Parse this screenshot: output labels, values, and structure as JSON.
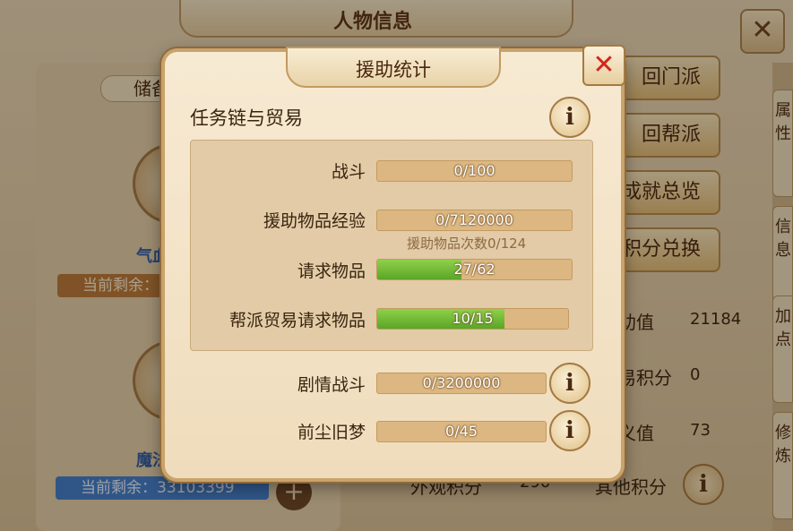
{
  "background": {
    "title": "人物信息",
    "close_icon": "close-icon",
    "left": {
      "store_label": "储备",
      "qi_label": "气血",
      "remain1_label": "当前剩余：",
      "mo_label": "魔法",
      "remain2_label": "当前剩余：33103399",
      "plus_icon": "plus-icon"
    },
    "buttons": [
      "回门派",
      "回帮派",
      "成就总览",
      "积分兑换"
    ],
    "stats": [
      {
        "label": "助值",
        "value": "21184"
      },
      {
        "label": "易积分",
        "value": "0"
      },
      {
        "label": "义值",
        "value": "73"
      }
    ],
    "bottom_left_label": "外观积分",
    "bottom_left_value": "290",
    "bottom_right_label": "其他积分",
    "right_tabs": [
      "属性",
      "信息",
      "加点",
      "修炼"
    ]
  },
  "dialog": {
    "title": "援助统计",
    "close_icon": "close-icon",
    "section_title": "任务链与贸易",
    "rows": [
      {
        "label": "战斗",
        "text": "0/100",
        "fill": 0
      },
      {
        "label": "援助物品经验",
        "text": "0/7120000",
        "fill": 0,
        "sub": "援助物品次数0/124"
      },
      {
        "label": "请求物品",
        "text": "27/62",
        "fill": 0.435
      },
      {
        "label": "帮派贸易请求物品",
        "text": "10/15",
        "fill": 0.667
      }
    ],
    "extra_rows": [
      {
        "label": "剧情战斗",
        "text": "0/3200000",
        "fill": 0
      },
      {
        "label": "前尘旧梦",
        "text": "0/45",
        "fill": 0
      }
    ],
    "info_icon_glyph": "i"
  },
  "colors": {
    "progress_green": "#6cbc35",
    "close_red": "#d4241b",
    "dialog_bg": "#f7ead2"
  }
}
